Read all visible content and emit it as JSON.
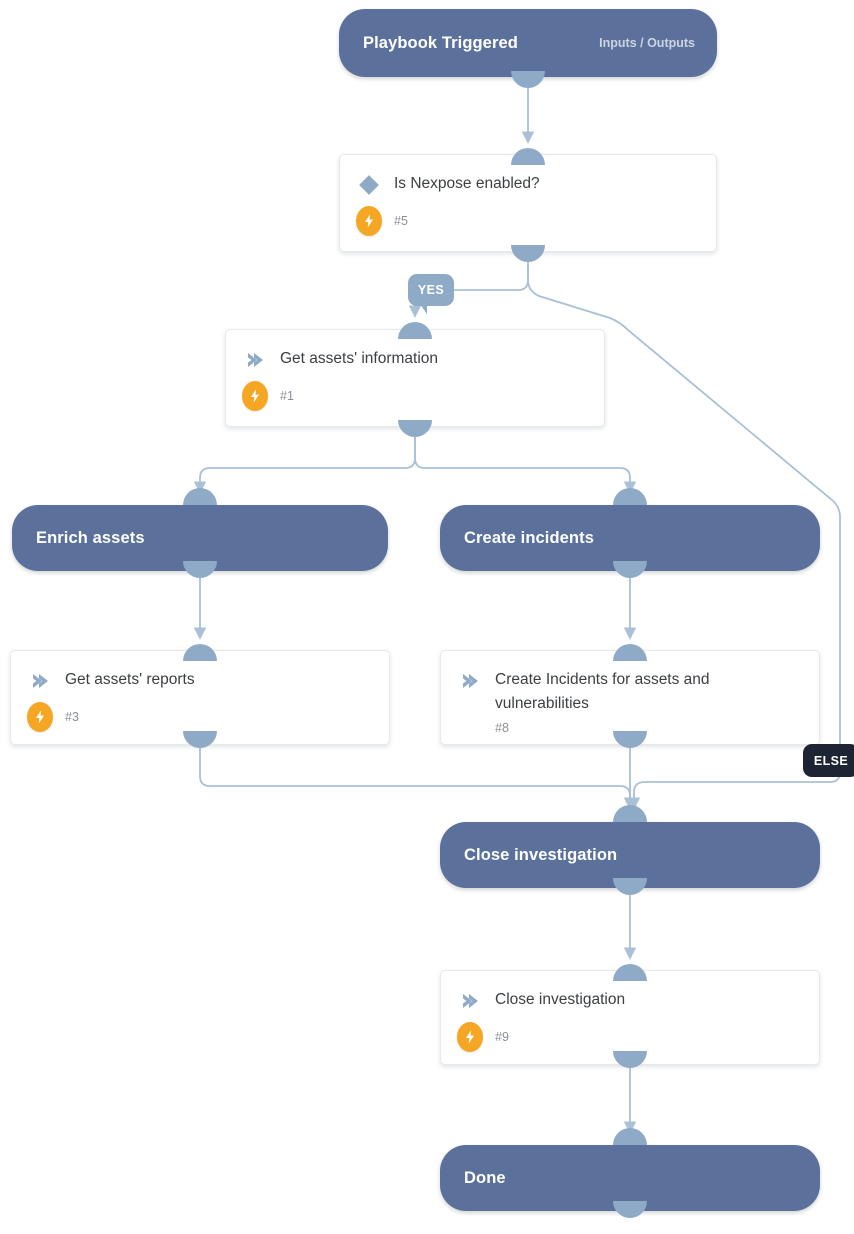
{
  "diagram": {
    "type": "playbook-workflow",
    "colors": {
      "section_fill": "#5b719c",
      "port": "#8faac6",
      "edge": "#a9c0d6",
      "bolt": "#f5a623",
      "chevron": "#8faac6",
      "diamond": "#8faac6",
      "else_badge": "#1d2433",
      "canvas": "#ffffff"
    },
    "sections": [
      {
        "id": "playbook-triggered",
        "title": "Playbook Triggered",
        "subtitle": "Inputs / Outputs"
      },
      {
        "id": "enrich-assets",
        "title": "Enrich assets",
        "subtitle": ""
      },
      {
        "id": "create-incidents",
        "title": "Create incidents",
        "subtitle": ""
      },
      {
        "id": "close-investigation",
        "title": "Close investigation",
        "subtitle": ""
      },
      {
        "id": "done",
        "title": "Done",
        "subtitle": ""
      }
    ],
    "tasks": [
      {
        "id": "is-nexpose-enabled",
        "label": "Is Nexpose enabled?",
        "number": "#5",
        "icon": "diamond",
        "has_bolt": true
      },
      {
        "id": "get-assets-information",
        "label": "Get assets' information",
        "number": "#1",
        "icon": "chevron",
        "has_bolt": true
      },
      {
        "id": "get-assets-reports",
        "label": "Get assets' reports",
        "number": "#3",
        "icon": "chevron",
        "has_bolt": true
      },
      {
        "id": "create-incidents-for-assets",
        "label": "Create Incidents for assets and vulnerabilities",
        "number": "#8",
        "icon": "chevron",
        "has_bolt": false
      },
      {
        "id": "close-investigation-task",
        "label": "Close investigation",
        "number": "#9",
        "icon": "chevron",
        "has_bolt": true
      }
    ],
    "badges": [
      {
        "id": "yes",
        "label": "YES"
      },
      {
        "id": "else",
        "label": "ELSE"
      }
    ]
  }
}
